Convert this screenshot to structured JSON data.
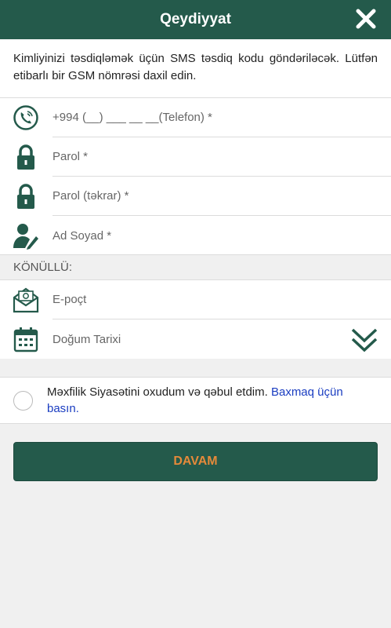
{
  "header": {
    "title": "Qeydiyyat"
  },
  "intro": {
    "text": "Kimliyinizi təsdiqləmək üçün SMS təsdiq kodu göndəriləcək. Lütfən etibarlı bir GSM nömrəsi daxil edin."
  },
  "fields": {
    "phone": {
      "placeholder": "+994 (__) ___ __ __(Telefon) *",
      "icon": "phone-icon"
    },
    "password": {
      "placeholder": "Parol *",
      "icon": "lock-icon"
    },
    "password_repeat": {
      "placeholder": "Parol (təkrar) *",
      "icon": "lock-icon"
    },
    "full_name": {
      "placeholder": "Ad Soyad *",
      "icon": "user-edit-icon"
    }
  },
  "optional": {
    "label": "KÖNÜLLÜ:",
    "email": {
      "placeholder": "E-poçt",
      "icon": "email-icon"
    },
    "birth_date": {
      "placeholder": "Doğum Tarixi",
      "icon": "calendar-icon"
    }
  },
  "policy": {
    "text": "Məxfilik Siyasətini oxudum və qəbul etdim.",
    "link": "Baxmaq üçün basın."
  },
  "actions": {
    "continue": "DAVAM"
  },
  "colors": {
    "primary": "#245a4b",
    "accent": "#e58a3a",
    "link": "#1a3dc1"
  }
}
